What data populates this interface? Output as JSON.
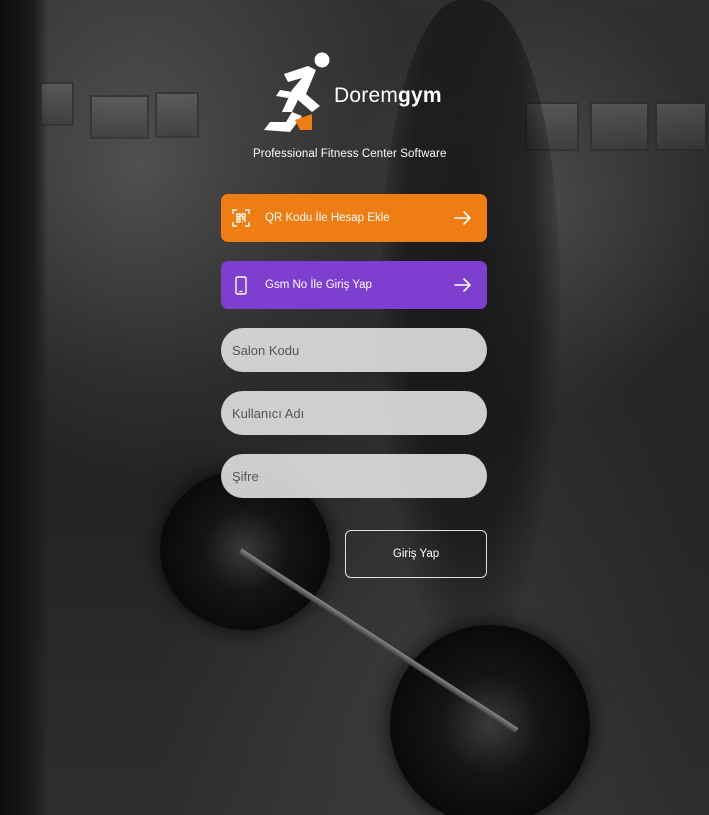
{
  "brand": {
    "name_light": "Dorem",
    "name_bold": "gym",
    "tagline": "Professional Fitness Center Software",
    "accent_orange": "#ee7d14",
    "accent_purple": "#7e3fd1"
  },
  "actions": {
    "qr": {
      "label": "QR Kodu İle Hesap Ekle",
      "icon": "qr-scan-icon"
    },
    "gsm": {
      "label": "Gsm No İle Giriş Yap",
      "icon": "mobile-phone-icon"
    }
  },
  "form": {
    "salon_code_placeholder": "Salon Kodu",
    "username_placeholder": "Kullanıcı Adı",
    "password_placeholder": "Şifre",
    "login_label": "Giriş Yap"
  }
}
